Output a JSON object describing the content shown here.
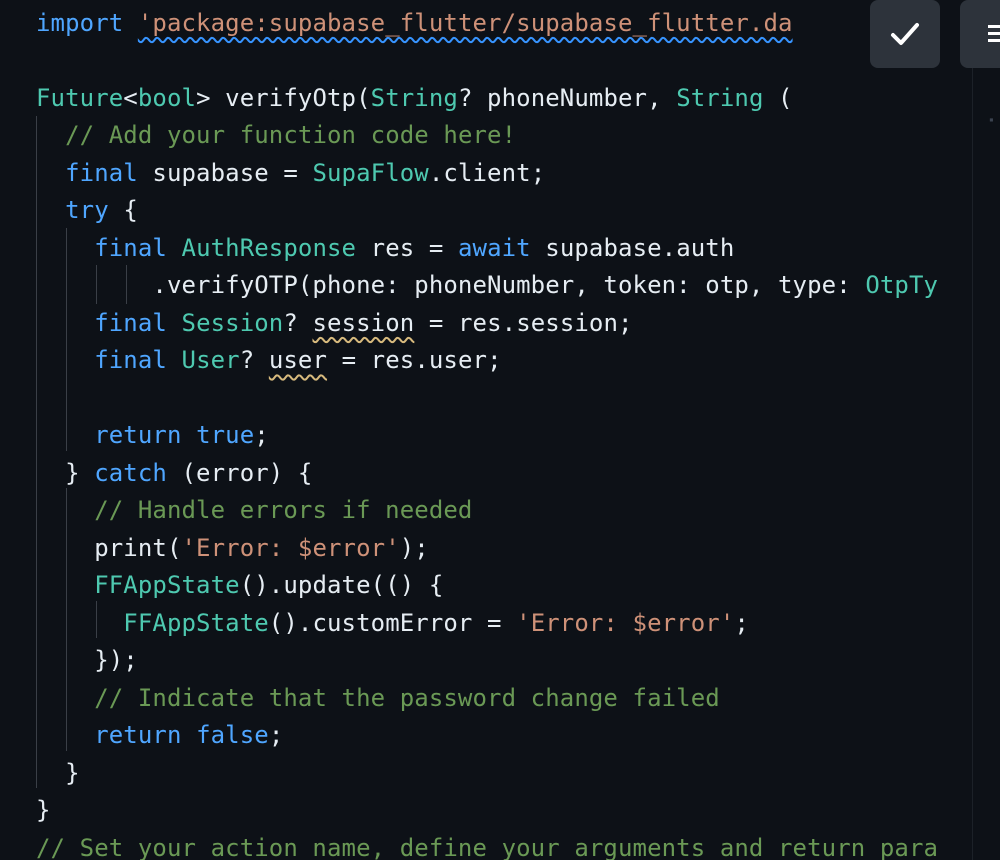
{
  "colors": {
    "background": "#0d1117",
    "keyword": "#4fa6ff",
    "type": "#4ec9b0",
    "string": "#ce9178",
    "comment": "#6a9955",
    "plain": "#e6edf3",
    "button_bg": "#2d333b"
  },
  "toolbar": {
    "confirm_icon": "check-icon",
    "menu_icon": "menu-icon"
  },
  "code": {
    "lines": [
      [
        {
          "t": "kw",
          "v": "import"
        },
        {
          "t": "plain",
          "v": " "
        },
        {
          "t": "str squiggle-blue",
          "v": "'package:supabase_flutter/supabase_flutter.da"
        }
      ],
      [],
      [
        {
          "t": "type",
          "v": "Future"
        },
        {
          "t": "plain",
          "v": "<"
        },
        {
          "t": "type",
          "v": "bool"
        },
        {
          "t": "plain",
          "v": "> verifyOtp("
        },
        {
          "t": "type",
          "v": "String"
        },
        {
          "t": "plain",
          "v": "? phoneNumber, "
        },
        {
          "t": "type",
          "v": "String"
        },
        {
          "t": "plain",
          "v": " ("
        }
      ],
      [
        {
          "t": "plain",
          "v": "  "
        },
        {
          "t": "comment",
          "v": "// Add your function code here!"
        }
      ],
      [
        {
          "t": "plain",
          "v": "  "
        },
        {
          "t": "kw",
          "v": "final"
        },
        {
          "t": "plain",
          "v": " supabase = "
        },
        {
          "t": "type",
          "v": "SupaFlow"
        },
        {
          "t": "plain",
          "v": ".client;"
        }
      ],
      [
        {
          "t": "plain",
          "v": "  "
        },
        {
          "t": "kw",
          "v": "try"
        },
        {
          "t": "plain",
          "v": " {"
        }
      ],
      [
        {
          "t": "plain",
          "v": "    "
        },
        {
          "t": "kw",
          "v": "final"
        },
        {
          "t": "plain",
          "v": " "
        },
        {
          "t": "type",
          "v": "AuthResponse"
        },
        {
          "t": "plain",
          "v": " res = "
        },
        {
          "t": "kw",
          "v": "await"
        },
        {
          "t": "plain",
          "v": " supabase.auth"
        }
      ],
      [
        {
          "t": "plain",
          "v": "        .verifyOTP(phone: phoneNumber, token: otp, type: "
        },
        {
          "t": "type",
          "v": "OtpTy"
        }
      ],
      [
        {
          "t": "plain",
          "v": "    "
        },
        {
          "t": "kw",
          "v": "final"
        },
        {
          "t": "plain",
          "v": " "
        },
        {
          "t": "type",
          "v": "Session"
        },
        {
          "t": "plain",
          "v": "? "
        },
        {
          "t": "plain squiggle",
          "v": "session"
        },
        {
          "t": "plain",
          "v": " = res.session;"
        }
      ],
      [
        {
          "t": "plain",
          "v": "    "
        },
        {
          "t": "kw",
          "v": "final"
        },
        {
          "t": "plain",
          "v": " "
        },
        {
          "t": "type",
          "v": "User"
        },
        {
          "t": "plain",
          "v": "? "
        },
        {
          "t": "plain squiggle",
          "v": "user"
        },
        {
          "t": "plain",
          "v": " = res.user;"
        }
      ],
      [],
      [
        {
          "t": "plain",
          "v": "    "
        },
        {
          "t": "kw",
          "v": "return"
        },
        {
          "t": "plain",
          "v": " "
        },
        {
          "t": "kw",
          "v": "true"
        },
        {
          "t": "plain",
          "v": ";"
        }
      ],
      [
        {
          "t": "plain",
          "v": "  } "
        },
        {
          "t": "kw",
          "v": "catch"
        },
        {
          "t": "plain",
          "v": " (error) {"
        }
      ],
      [
        {
          "t": "plain",
          "v": "    "
        },
        {
          "t": "comment",
          "v": "// Handle errors if needed"
        }
      ],
      [
        {
          "t": "plain",
          "v": "    print("
        },
        {
          "t": "str",
          "v": "'Error: $error'"
        },
        {
          "t": "plain",
          "v": ");"
        }
      ],
      [
        {
          "t": "plain",
          "v": "    "
        },
        {
          "t": "type",
          "v": "FFAppState"
        },
        {
          "t": "plain",
          "v": "().update(() {"
        }
      ],
      [
        {
          "t": "plain",
          "v": "      "
        },
        {
          "t": "type",
          "v": "FFAppState"
        },
        {
          "t": "plain",
          "v": "().customError = "
        },
        {
          "t": "str",
          "v": "'Error: $error'"
        },
        {
          "t": "plain",
          "v": ";"
        }
      ],
      [
        {
          "t": "plain",
          "v": "    });"
        }
      ],
      [
        {
          "t": "plain",
          "v": "    "
        },
        {
          "t": "comment",
          "v": "// Indicate that the password change failed"
        }
      ],
      [
        {
          "t": "plain",
          "v": "    "
        },
        {
          "t": "kw",
          "v": "return"
        },
        {
          "t": "plain",
          "v": " "
        },
        {
          "t": "kw",
          "v": "false"
        },
        {
          "t": "plain",
          "v": ";"
        }
      ],
      [
        {
          "t": "plain",
          "v": "  }"
        }
      ],
      [
        {
          "t": "plain",
          "v": "}"
        }
      ],
      [
        {
          "t": "comment",
          "v": "// Set your action name, define your arguments and return para"
        }
      ]
    ]
  }
}
